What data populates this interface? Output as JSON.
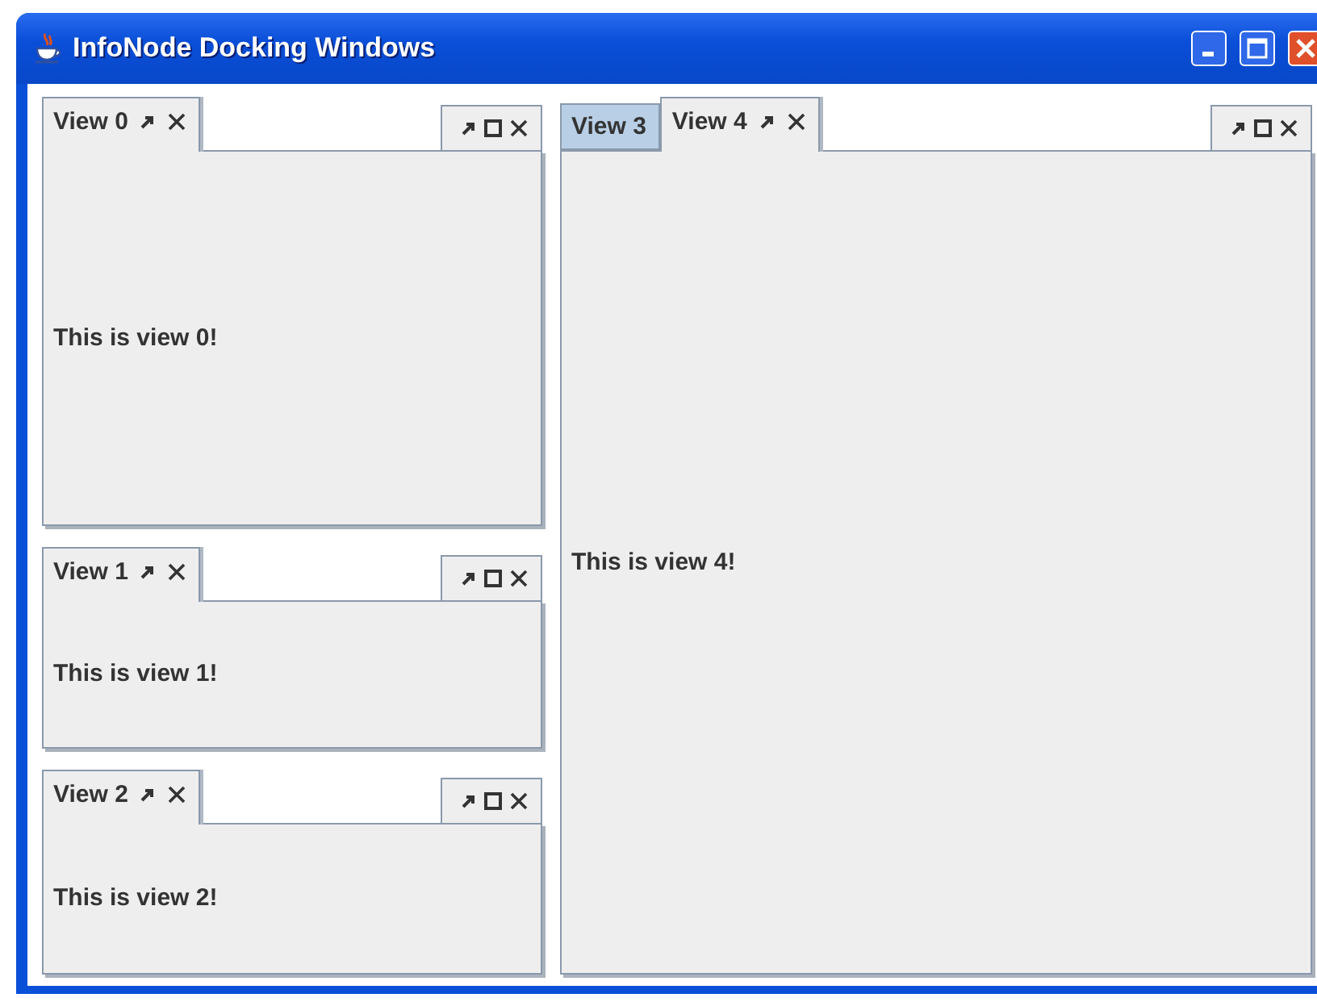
{
  "window": {
    "title": "InfoNode Docking Windows"
  },
  "columns": [
    {
      "panels": [
        {
          "tabs": [
            {
              "label": "View 0",
              "selected": true
            }
          ],
          "content": "This is view 0!"
        },
        {
          "tabs": [
            {
              "label": "View 1",
              "selected": true
            }
          ],
          "content": "This is view 1!"
        },
        {
          "tabs": [
            {
              "label": "View 2",
              "selected": true
            }
          ],
          "content": "This is view 2!"
        }
      ]
    },
    {
      "panels": [
        {
          "tabs": [
            {
              "label": "View 3",
              "selected": false
            },
            {
              "label": "View 4",
              "selected": true
            }
          ],
          "content": "This is view 4!"
        }
      ]
    }
  ]
}
